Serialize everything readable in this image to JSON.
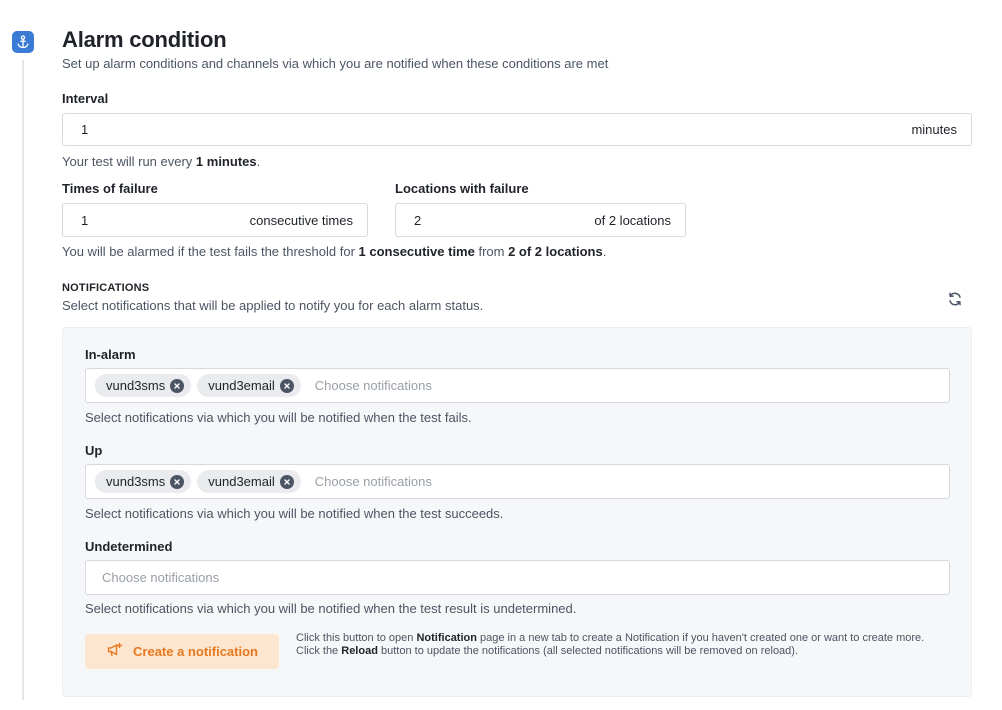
{
  "section": {
    "title": "Alarm condition",
    "subtitle": "Set up alarm conditions and channels via which you are notified when these conditions are met"
  },
  "interval": {
    "label": "Interval",
    "value": "1",
    "unit": "minutes",
    "help_prefix": "Your test will run every ",
    "help_value": "1 minutes",
    "help_suffix": "."
  },
  "times_of_failure": {
    "label": "Times of failure",
    "value": "1",
    "suffix": "consecutive times"
  },
  "locations_with_failure": {
    "label": "Locations with failure",
    "value": "2",
    "suffix": "of 2 locations"
  },
  "threshold_help": {
    "prefix": "You will be alarmed if the test fails the threshold for ",
    "times": "1 consecutive time",
    "middle": " from ",
    "locations": "2 of 2 locations",
    "suffix": "."
  },
  "notifications": {
    "heading": "NOTIFICATIONS",
    "description": "Select notifications that will be applied to notify you for each alarm status.",
    "groups": [
      {
        "label": "In-alarm",
        "tags": [
          "vund3sms",
          "vund3email"
        ],
        "placeholder": "Choose notifications",
        "help": "Select notifications via which you will be notified when the test fails."
      },
      {
        "label": "Up",
        "tags": [
          "vund3sms",
          "vund3email"
        ],
        "placeholder": "Choose notifications",
        "help": "Select notifications via which you will be notified when the test succeeds."
      },
      {
        "label": "Undetermined",
        "tags": [],
        "placeholder": "Choose notifications",
        "help": "Select notifications via which you will be notified when the test result is undetermined."
      }
    ],
    "create_button": "Create a notification",
    "create_note": {
      "p1": "Click this button to open ",
      "b1": "Notification",
      "p2": " page in a new tab to create a Notification if you haven't created one or want to create more. Click the ",
      "b2": "Reload",
      "p3": " button to update the notifications (all selected notifications will be removed on reload)."
    }
  },
  "icons": {
    "step": "anchor-icon",
    "reload": "reload-icon",
    "remove_tag": "close-circle-icon",
    "create": "megaphone-plus-icon"
  },
  "colors": {
    "step_badge": "#3a7bd5",
    "create_button_bg": "#fde6cf",
    "create_button_text": "#e8791f"
  }
}
